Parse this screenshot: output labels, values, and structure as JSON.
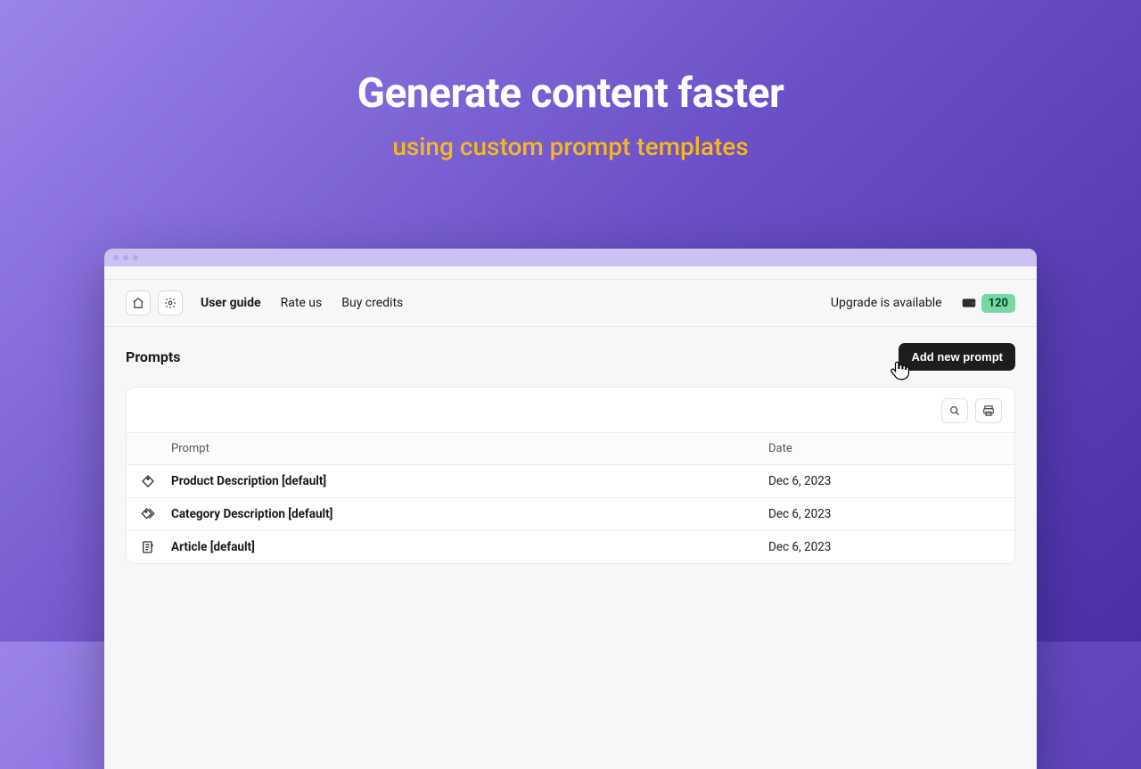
{
  "hero": {
    "title": "Generate content faster",
    "subtitle": "using custom prompt templates"
  },
  "toolbar": {
    "links": {
      "user_guide": "User guide",
      "rate_us": "Rate us",
      "buy_credits": "Buy credits"
    },
    "upgrade": "Upgrade is available",
    "credits": "120"
  },
  "page": {
    "title": "Prompts",
    "add_button": "Add new prompt"
  },
  "table": {
    "headers": {
      "prompt": "Prompt",
      "date": "Date"
    },
    "rows": [
      {
        "icon": "tag",
        "name": "Product Description [default]",
        "date": "Dec 6, 2023"
      },
      {
        "icon": "tags",
        "name": "Category Description [default]",
        "date": "Dec 6, 2023"
      },
      {
        "icon": "article",
        "name": "Article [default]",
        "date": "Dec 6, 2023"
      }
    ]
  }
}
